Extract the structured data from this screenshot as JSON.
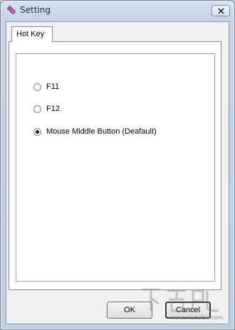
{
  "window": {
    "title": "Setting"
  },
  "tabs": [
    {
      "label": "Hot Key",
      "selected": true
    }
  ],
  "hotkey_options": [
    {
      "label": "F11",
      "checked": false
    },
    {
      "label": "F12",
      "checked": false
    },
    {
      "label": "Mouse Middle Button (Deafault)",
      "checked": true
    }
  ],
  "buttons": {
    "ok": "OK",
    "cancel": "Cancel"
  },
  "watermark": {
    "text": "www.xiazaiba.com"
  },
  "icons": {
    "app": "eraser-icon",
    "close": "close-icon"
  },
  "colors": {
    "accent": "#c94bb8",
    "titlebar": "#c9d6e5"
  }
}
